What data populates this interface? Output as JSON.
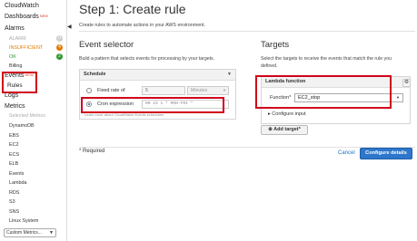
{
  "sidebar": {
    "cloudwatch": "CloudWatch",
    "dashboards": "Dashboards",
    "dashboards_new": "NEW",
    "alarms": "Alarms",
    "alarm": "ALARM",
    "alarm_count": "0",
    "insufficient": "INSUFFICIENT",
    "insufficient_count": "4",
    "ok": "OK",
    "ok_count": "2",
    "billing": "Billing",
    "events": "Events",
    "events_new": "NEW",
    "rules": "Rules",
    "logs": "Logs",
    "metrics": "Metrics",
    "selected_metrics": "Selected Metrics",
    "metric_items": [
      "DynamoDB",
      "EBS",
      "EC2",
      "ECS",
      "ELB",
      "Events",
      "Lambda",
      "RDS",
      "S3",
      "SNS",
      "Linux System"
    ],
    "custom_metrics": "Custom Metrics..."
  },
  "main": {
    "title": "Step 1: Create rule",
    "subtitle": "Create rules to automate actions in your AWS environment."
  },
  "event_selector": {
    "title": "Event selector",
    "description": "Build a pattern that selects events for processing by your targets.",
    "schedule_label": "Schedule",
    "fixed_rate_label": "Fixed rate of",
    "fixed_rate_value": "5",
    "minutes_label": "Minutes",
    "cron_label": "Cron expression",
    "cron_value": "00 23 1 * MON-FRI *",
    "learn_more": "Learn more about CloudWatch Events schedules."
  },
  "targets": {
    "title": "Targets",
    "description_line1": "Select the targets to receive the events that match the rule you",
    "description_line2": "defined.",
    "type_label": "Lambda function",
    "function_label": "Function*",
    "function_value": "EC2_stop",
    "configure_input": "Configure input",
    "add_target": "Add target*"
  },
  "footer": {
    "required": "* Required",
    "cancel": "Cancel",
    "configure_details": "Configure details"
  },
  "colors": {
    "accent": "#2d76cc",
    "highlight": "#d0021b",
    "insufficient": "#e07b00",
    "ok": "#2c9a2c"
  }
}
